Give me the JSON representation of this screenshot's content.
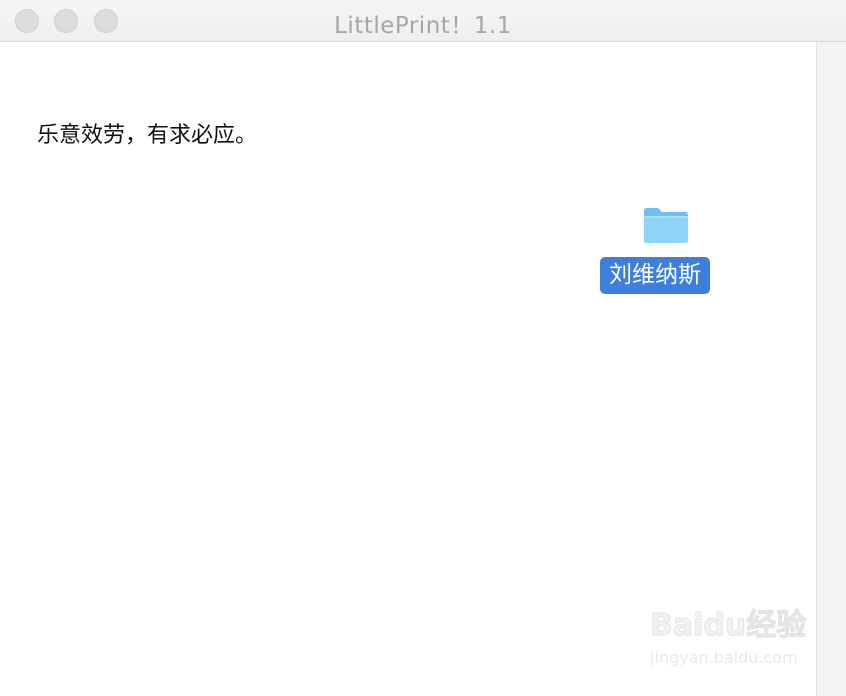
{
  "window": {
    "title": "LittlePrint！1.1"
  },
  "content": {
    "message": "乐意效劳，有求必应。"
  },
  "folder": {
    "label": "刘维纳斯",
    "icon": "folder-icon",
    "selection_color": "#3e7fdc",
    "icon_color": "#7cc8f6"
  },
  "watermark": {
    "main": "Baidu经验",
    "sub": "jingyan.baidu.com"
  }
}
